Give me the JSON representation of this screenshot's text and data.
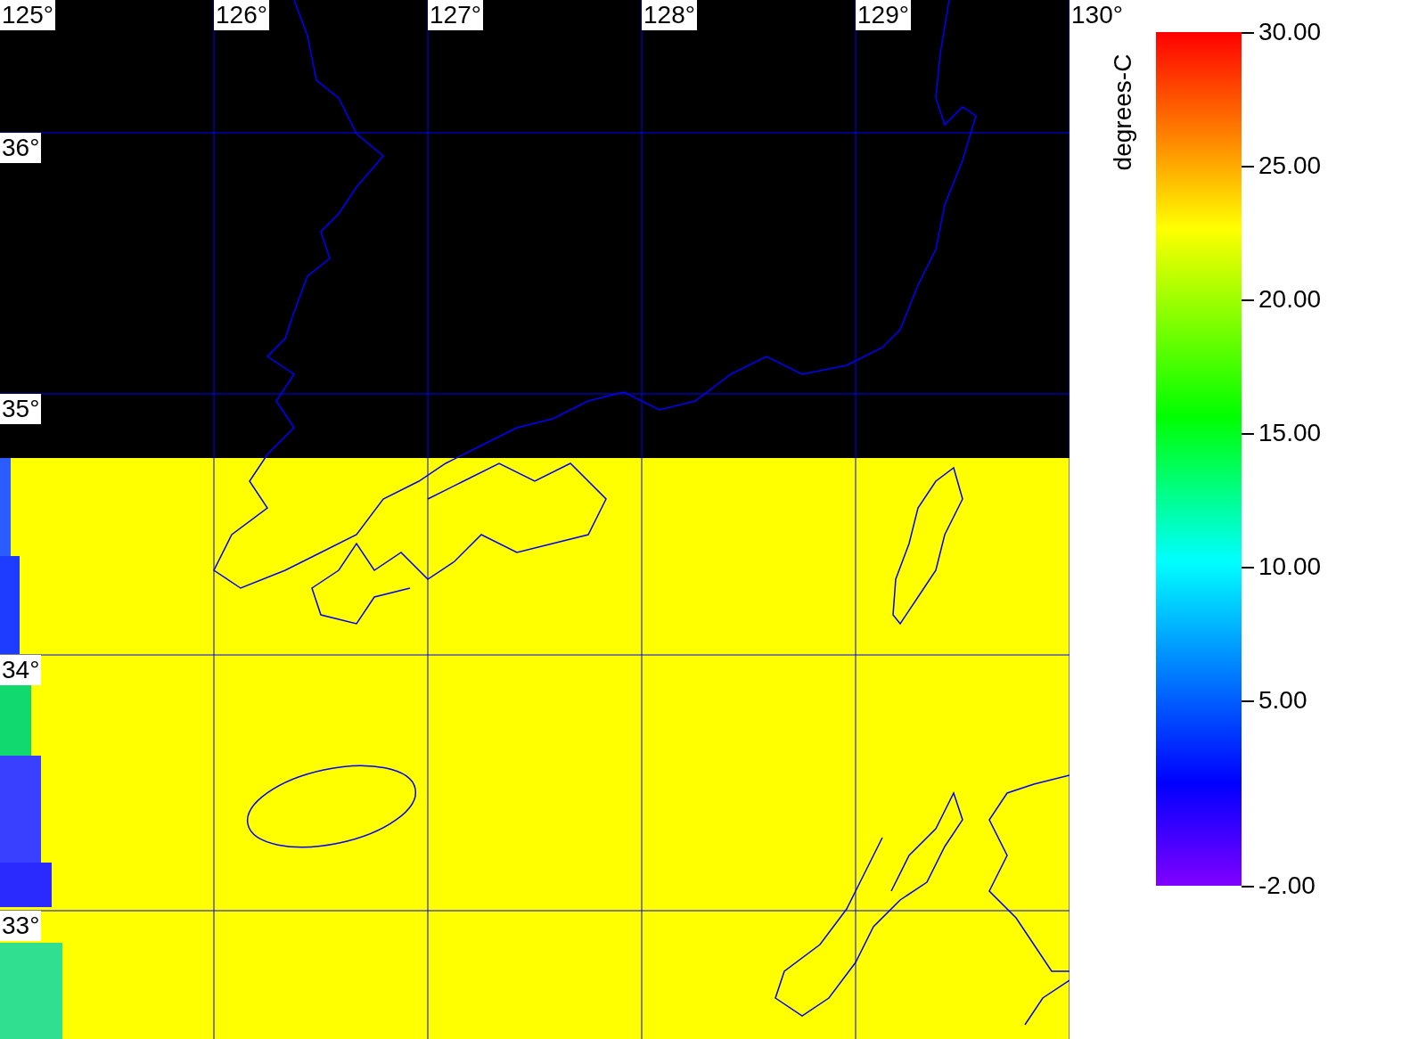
{
  "map": {
    "lon_labels": [
      "125°",
      "126°",
      "127°",
      "128°",
      "129°",
      "130°"
    ],
    "lat_labels": [
      "36°",
      "35°",
      "34°",
      "33°"
    ]
  },
  "colorbar": {
    "title": "degrees-C",
    "ticks": [
      "30.00",
      "25.00",
      "20.00",
      "15.00",
      "10.00",
      "5.00",
      "-2.00"
    ]
  }
}
